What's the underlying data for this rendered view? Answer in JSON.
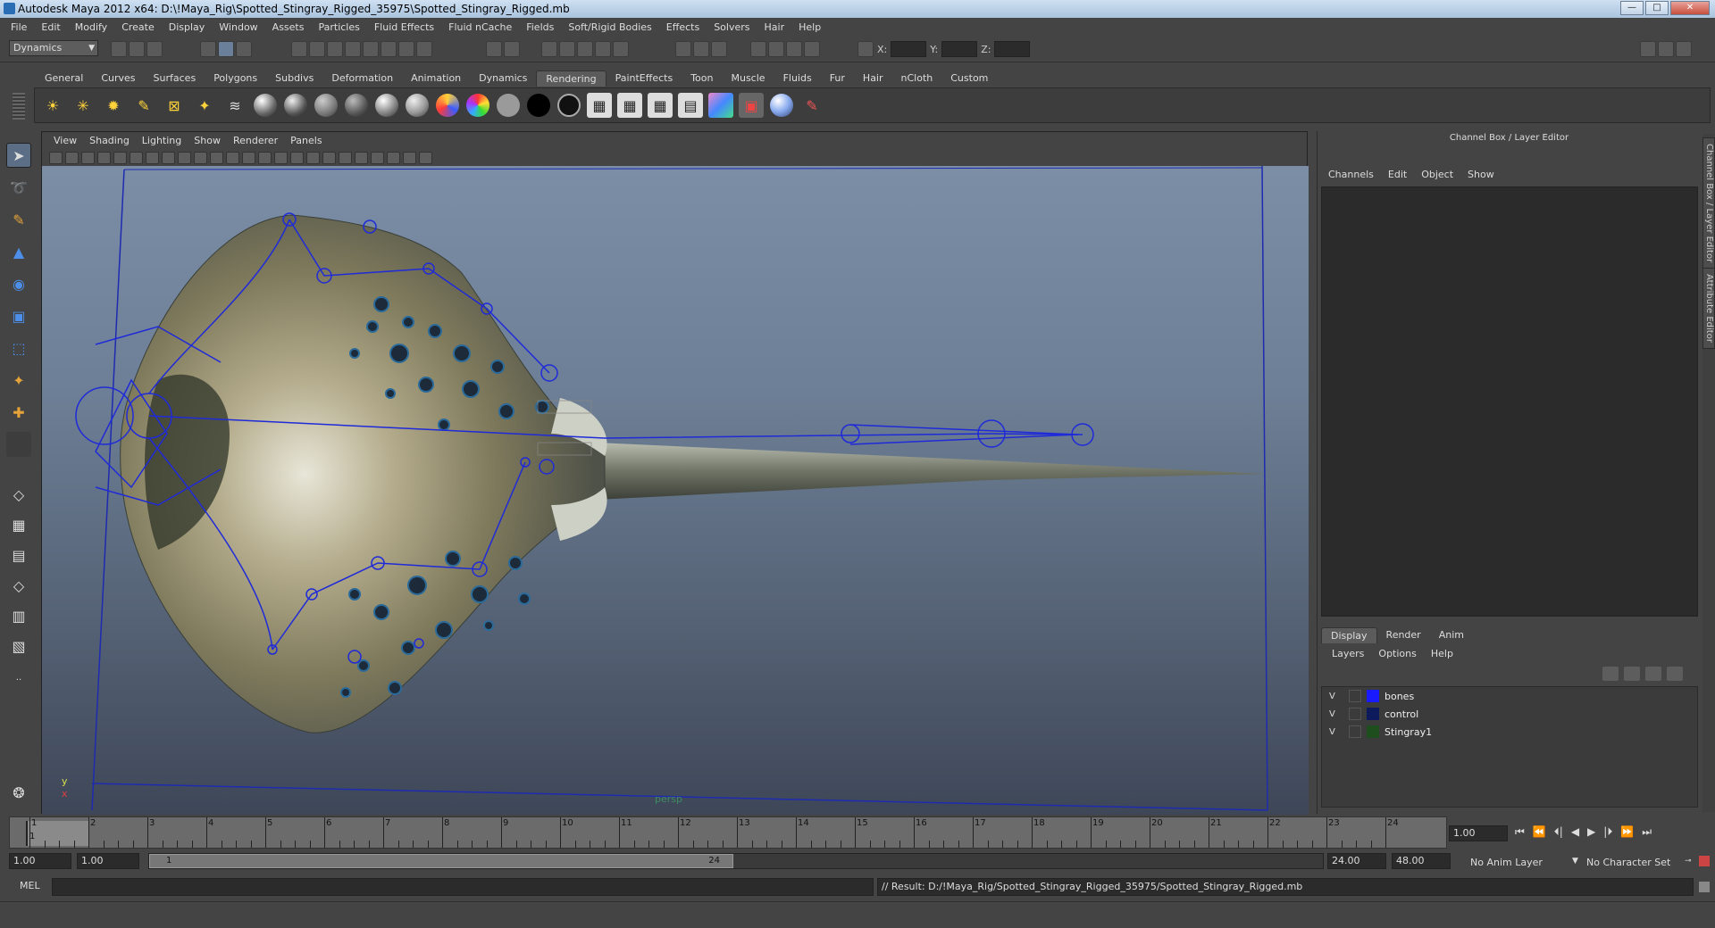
{
  "window": {
    "title": "Autodesk Maya 2012 x64: D:\\!Maya_Rig\\Spotted_Stingray_Rigged_35975\\Spotted_Stingray_Rigged.mb",
    "minimize": "—",
    "maximize": "□",
    "close": "✕"
  },
  "menubar": [
    "File",
    "Edit",
    "Modify",
    "Create",
    "Display",
    "Window",
    "Assets",
    "Particles",
    "Fluid Effects",
    "Fluid nCache",
    "Fields",
    "Soft/Rigid Bodies",
    "Effects",
    "Solvers",
    "Hair",
    "Help"
  ],
  "statusline": {
    "mode": "Dynamics",
    "x_label": "X:",
    "y_label": "Y:",
    "z_label": "Z:"
  },
  "shelf_tabs": [
    "General",
    "Curves",
    "Surfaces",
    "Polygons",
    "Subdivs",
    "Deformation",
    "Animation",
    "Dynamics",
    "Rendering",
    "PaintEffects",
    "Toon",
    "Muscle",
    "Fluids",
    "Fur",
    "Hair",
    "nCloth",
    "Custom"
  ],
  "active_shelf_tab": "Rendering",
  "viewport": {
    "menu": [
      "View",
      "Shading",
      "Lighting",
      "Show",
      "Renderer",
      "Panels"
    ],
    "camera_label": "persp",
    "axis_y": "y",
    "axis_x": "x"
  },
  "channel_box": {
    "title": "Channel Box / Layer Editor",
    "menu": [
      "Channels",
      "Edit",
      "Object",
      "Show"
    ]
  },
  "side_tabs": [
    "Channel Box / Layer Editor",
    "Attribute Editor"
  ],
  "layer_editor": {
    "tabs": [
      "Display",
      "Render",
      "Anim"
    ],
    "active_tab": "Display",
    "menu": [
      "Layers",
      "Options",
      "Help"
    ],
    "layers": [
      {
        "visible": "V",
        "name": "bones",
        "color": "#1a1aff"
      },
      {
        "visible": "V",
        "name": "control",
        "color": "#0d1a5c"
      },
      {
        "visible": "V",
        "name": "Stingray1",
        "color": "#1e4d1e"
      }
    ]
  },
  "timeline": {
    "frames": [
      "1",
      "2",
      "3",
      "4",
      "5",
      "6",
      "7",
      "8",
      "9",
      "10",
      "11",
      "12",
      "13",
      "14",
      "15",
      "16",
      "17",
      "18",
      "19",
      "20",
      "21",
      "22",
      "23",
      "24"
    ],
    "current_frame_marker": "1",
    "current_time": "1.00"
  },
  "range": {
    "start_time": "1.00",
    "playback_start": "1.00",
    "slider_start": "1",
    "slider_end": "24",
    "playback_end": "24.00",
    "end_time": "48.00",
    "anim_layer": "No Anim Layer",
    "character_set": "No Character Set"
  },
  "command": {
    "lang": "MEL",
    "result": "// Result: D:/!Maya_Rig/Spotted_Stingray_Rigged_35975/Spotted_Stingray_Rigged.mb"
  },
  "playback_buttons": [
    "⏮",
    "⏪",
    "⏴|",
    "◀",
    "▶",
    "|⏵",
    "⏩",
    "⏭"
  ]
}
